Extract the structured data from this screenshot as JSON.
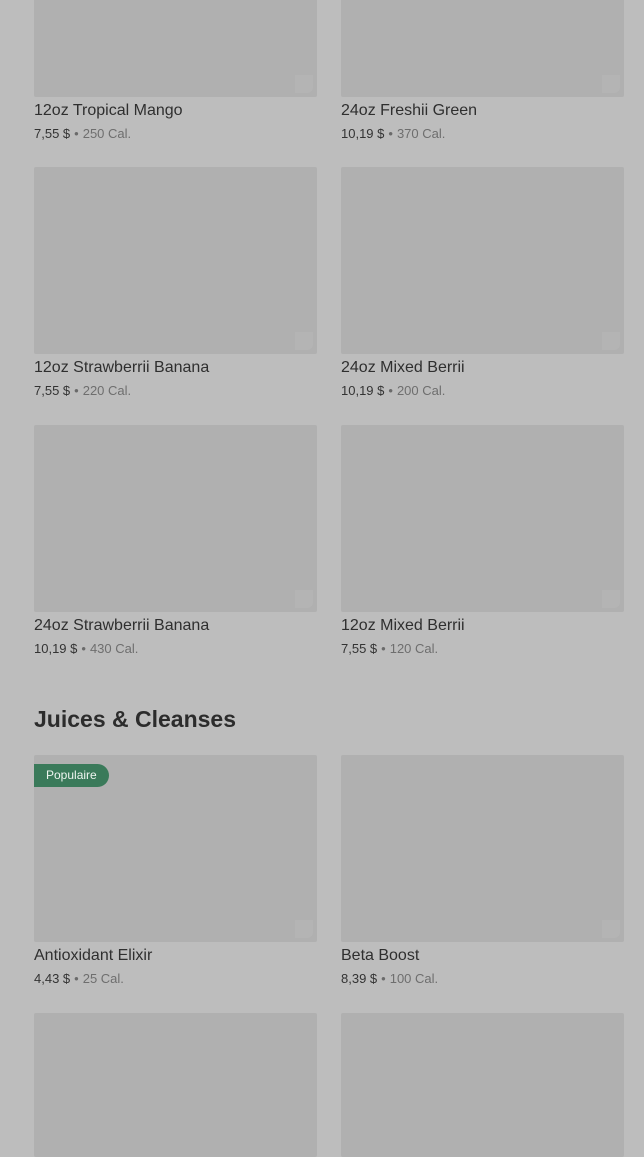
{
  "smoothies": [
    {
      "name": "12oz Tropical Mango",
      "price": "7,55 $",
      "sep": "•",
      "cal": "250 Cal."
    },
    {
      "name": "24oz Freshii Green",
      "price": "10,19 $",
      "sep": "•",
      "cal": "370 Cal."
    },
    {
      "name": "12oz Strawberrii Banana",
      "price": "7,55 $",
      "sep": "•",
      "cal": "220 Cal."
    },
    {
      "name": "24oz Mixed Berrii",
      "price": "10,19 $",
      "sep": "•",
      "cal": "200 Cal."
    },
    {
      "name": "24oz Strawberrii Banana",
      "price": "10,19 $",
      "sep": "•",
      "cal": "430 Cal."
    },
    {
      "name": "12oz Mixed Berrii",
      "price": "7,55 $",
      "sep": "•",
      "cal": "120 Cal."
    }
  ],
  "juices": {
    "section_title": "Juices & Cleanses",
    "items": [
      {
        "name": "Antioxidant Elixir",
        "price": "4,43 $",
        "sep": "•",
        "cal": "25 Cal.",
        "badge": "Populaire"
      },
      {
        "name": "Beta Boost",
        "price": "8,39 $",
        "sep": "•",
        "cal": "100 Cal."
      }
    ]
  },
  "colors": {
    "overlay_bg": "#bdbdbd",
    "image_placeholder": "#b0b0b0",
    "badge_bg": "#3a7a5a"
  }
}
